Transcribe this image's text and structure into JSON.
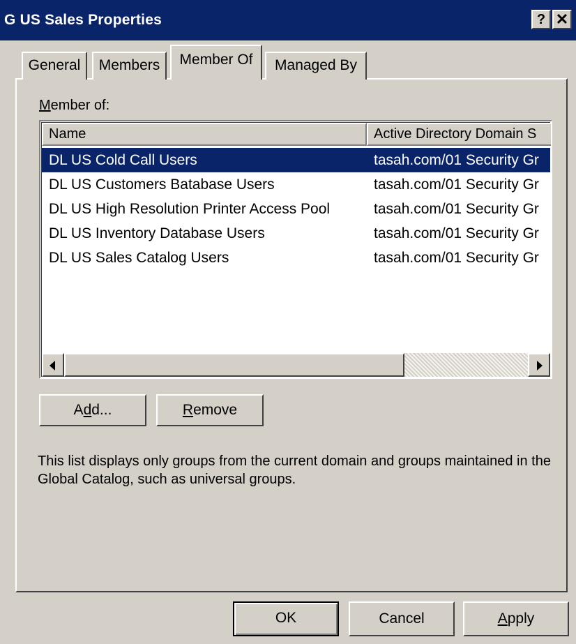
{
  "window": {
    "title": "G US Sales Properties",
    "help_label": "?",
    "close_label": "✕"
  },
  "tabs": [
    {
      "label": "General"
    },
    {
      "label": "Members"
    },
    {
      "label": "Member Of",
      "selected": true
    },
    {
      "label": "Managed By"
    }
  ],
  "member_of": {
    "label_prefix": "M",
    "label_rest": "ember of:",
    "columns": [
      "Name",
      "Active Directory Domain S"
    ],
    "rows": [
      {
        "name": "DL US Cold Call Users",
        "domain": "tasah.com/01 Security Gr",
        "selected": true
      },
      {
        "name": "DL US Customers Batabase Users",
        "domain": "tasah.com/01 Security Gr"
      },
      {
        "name": "DL US High Resolution Printer Access Pool",
        "domain": "tasah.com/01 Security Gr"
      },
      {
        "name": "DL US Inventory Database Users",
        "domain": "tasah.com/01 Security Gr"
      },
      {
        "name": "DL US Sales Catalog Users",
        "domain": "tasah.com/01 Security Gr"
      }
    ]
  },
  "buttons": {
    "add_pre": "A",
    "add_ul": "d",
    "add_post": "d...",
    "remove_ul": "R",
    "remove_post": "emove",
    "ok": "OK",
    "cancel": "Cancel",
    "apply_ul": "A",
    "apply_post": "pply"
  },
  "info": "This list displays only groups from the current domain and groups maintained in the Global Catalog, such as universal groups.",
  "colors": {
    "titlebar": "#0a246a",
    "selection": "#0a246a",
    "face": "#d4d0c8"
  }
}
